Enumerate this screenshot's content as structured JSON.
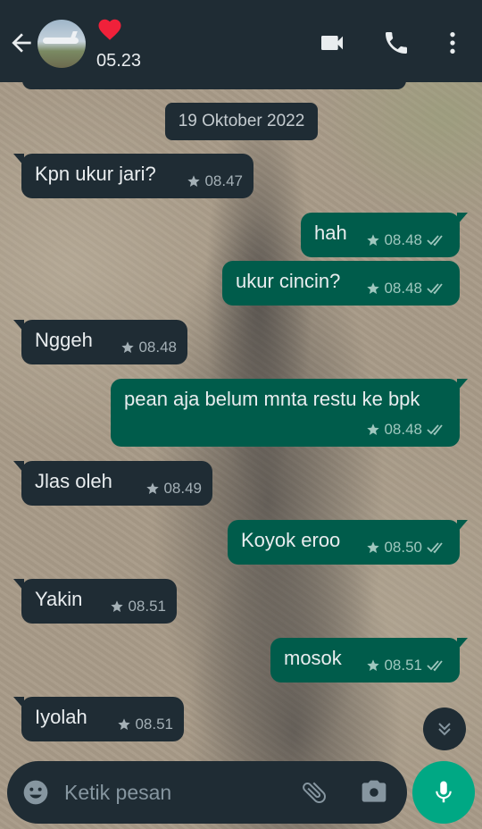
{
  "header": {
    "back_icon": "arrow-left-icon",
    "contact_emoji": "❤️",
    "contact_status": "05.23",
    "icons": [
      "video-call-icon",
      "voice-call-icon",
      "more-vert-icon"
    ]
  },
  "chat": {
    "date_chip": "19 Oktober 2022",
    "messages": [
      {
        "dir": "in",
        "text": "Kpn ukur jari?",
        "time": "08.47",
        "starred": true
      },
      {
        "dir": "out",
        "text": "hah",
        "time": "08.48",
        "starred": true,
        "read": true
      },
      {
        "dir": "out",
        "text": "ukur cincin?",
        "time": "08.48",
        "starred": true,
        "read": true
      },
      {
        "dir": "in",
        "text": "Nggeh",
        "time": "08.48",
        "starred": true
      },
      {
        "dir": "out",
        "text": "pean aja belum mnta restu ke bpk",
        "time": "08.48",
        "starred": true,
        "read": true
      },
      {
        "dir": "in",
        "text": "Jlas oleh",
        "time": "08.49",
        "starred": true
      },
      {
        "dir": "out",
        "text": "Koyok eroo",
        "time": "08.50",
        "starred": true,
        "read": true
      },
      {
        "dir": "in",
        "text": "Yakin",
        "time": "08.51",
        "starred": true
      },
      {
        "dir": "out",
        "text": "mosok",
        "time": "08.51",
        "starred": true,
        "read": true
      },
      {
        "dir": "in",
        "text": "Iyolah",
        "time": "08.51",
        "starred": true
      }
    ]
  },
  "composer": {
    "placeholder": "Ketik pesan",
    "icons": [
      "emoji-icon",
      "paperclip-icon",
      "camera-icon",
      "microphone-icon"
    ]
  },
  "colors": {
    "header_bg": "#1f2c34",
    "incoming_bubble": "#1f2c34",
    "outgoing_bubble": "#005c4b",
    "accent": "#00a884",
    "text": "#e9edef"
  }
}
